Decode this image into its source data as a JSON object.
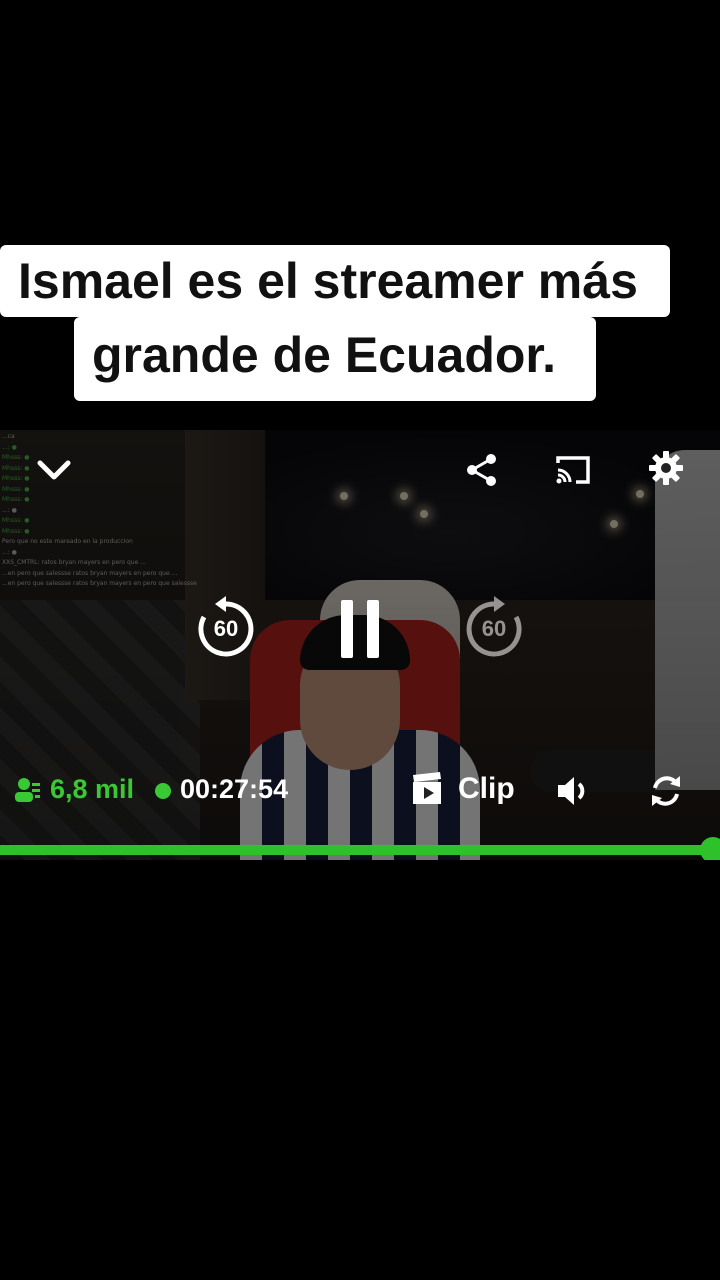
{
  "caption": {
    "line1": "Ismael es el streamer más",
    "line2": "grande de Ecuador."
  },
  "player": {
    "chat_lines": [
      {
        "text": "...ca",
        "color": "grey"
      },
      {
        "text": "...: ●",
        "color": "green"
      },
      {
        "text": "Mhsss: ●",
        "color": "green"
      },
      {
        "text": "Mhsss: ●",
        "color": "green"
      },
      {
        "text": "Mhsss: ●",
        "color": "green"
      },
      {
        "text": "Mhsss: ●",
        "color": "green"
      },
      {
        "text": "Mhsss: ●",
        "color": "green"
      },
      {
        "text": "...: ●",
        "color": "grey"
      },
      {
        "text": "Mhsss: ●",
        "color": "green"
      },
      {
        "text": "Mhsss: ●",
        "color": "green"
      },
      {
        "text": "Pero que no este mareado en la produccion",
        "color": "grey"
      },
      {
        "text": "...: ●",
        "color": "grey"
      },
      {
        "text": "XXS_CMTRL: ratos bryan mayers en pero que ...",
        "color": "grey"
      },
      {
        "text": "...en pero que salessse ratos bryan mayers en pero que ...",
        "color": "grey"
      },
      {
        "text": "...en pero que salessse ratos bryan mayers en pero que salessse",
        "color": "grey"
      }
    ],
    "seek_back_seconds": "60",
    "seek_forward_seconds": "60",
    "viewers": "6,8 mil",
    "uptime": "00:27:54",
    "clip_label": "Clip",
    "progress": 0.99,
    "icons": [
      "chevron-down-icon",
      "share-icon",
      "cast-icon",
      "gear-icon",
      "replay-icon",
      "pause-icon",
      "forward-icon",
      "viewers-icon",
      "clip-icon",
      "volume-icon",
      "rotate-icon"
    ],
    "accent_color": "#2fc12b"
  }
}
